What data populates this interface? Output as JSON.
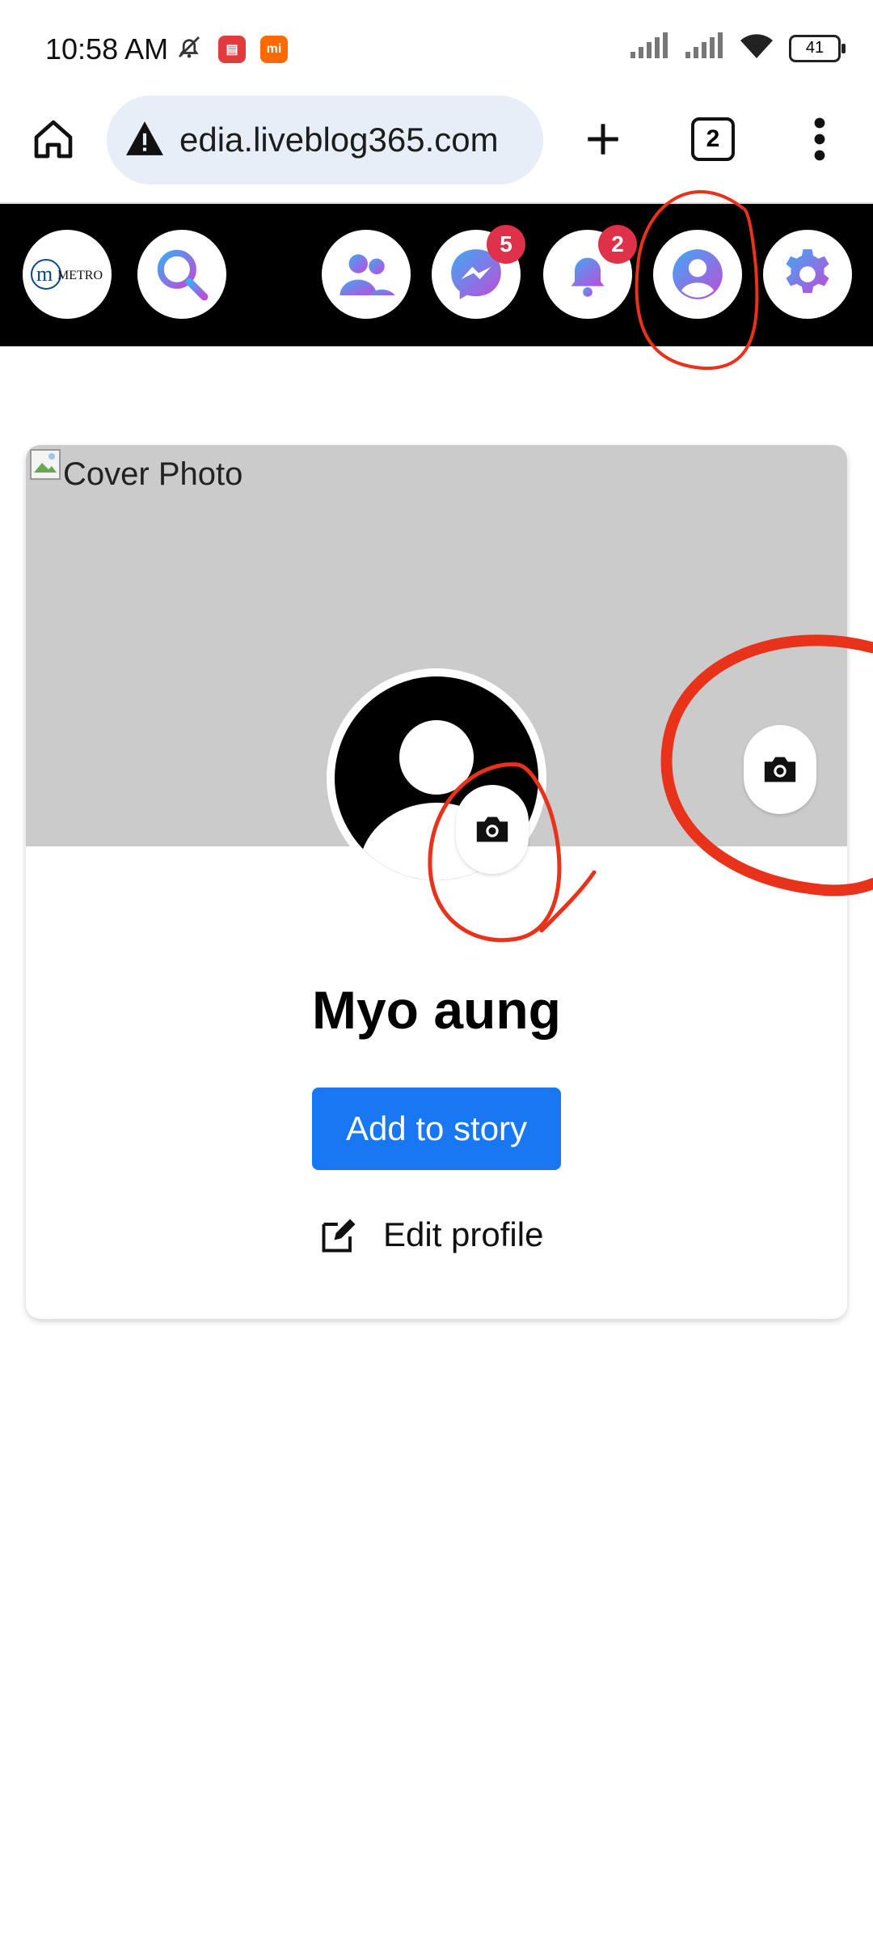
{
  "status_bar": {
    "time": "10:58 AM",
    "app_icons": [
      "muted-bell-icon",
      "news-app-icon",
      "mi-app-icon"
    ],
    "battery": "41"
  },
  "browser": {
    "url": "edia.liveblog365.com",
    "tab_count": "2"
  },
  "site_header": {
    "logo": "METRO",
    "badges": {
      "messenger": "5",
      "notifications": "2"
    },
    "accent_gradient": [
      "#3fa9f5",
      "#b24ad8"
    ]
  },
  "profile": {
    "cover_alt": "Cover Photo",
    "name": "Myo aung",
    "add_story_label": "Add to story",
    "edit_profile_label": "Edit profile"
  },
  "colors": {
    "header_bg": "#000000",
    "primary_button": "#1877f2",
    "badge": "#e0314b",
    "annotation": "#e8321a"
  }
}
